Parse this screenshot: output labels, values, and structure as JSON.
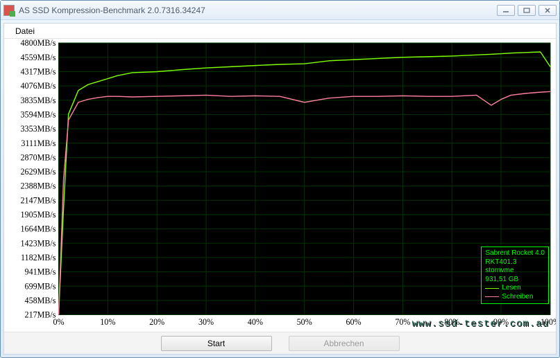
{
  "window": {
    "title": "AS SSD Kompression-Benchmark 2.0.7316.34247"
  },
  "menu": {
    "datei": "Datei"
  },
  "buttons": {
    "start": "Start",
    "abort": "Abbrechen"
  },
  "watermark": "www.ssd-tester.com.au",
  "legend": {
    "line1": "Sabrent Rocket 4.0",
    "line2": "RKT401.3",
    "line3": "stornvme",
    "line4": "931,51 GB",
    "read": "Lesen",
    "write": "Schreiben"
  },
  "chart_data": {
    "type": "line",
    "xlabel": "",
    "ylabel": "",
    "x_ticks": [
      "0%",
      "10%",
      "20%",
      "30%",
      "40%",
      "50%",
      "60%",
      "70%",
      "80%",
      "90%",
      "100%"
    ],
    "y_ticks": [
      "217MB/s",
      "458MB/s",
      "699MB/s",
      "941MB/s",
      "1182MB/s",
      "1423MB/s",
      "1664MB/s",
      "1905MB/s",
      "2147MB/s",
      "2388MB/s",
      "2629MB/s",
      "2870MB/s",
      "3111MB/s",
      "3353MB/s",
      "3594MB/s",
      "3835MB/s",
      "4076MB/s",
      "4317MB/s",
      "4559MB/s",
      "4800MB/s"
    ],
    "ylim": [
      217,
      4800
    ],
    "xlim": [
      0,
      100
    ],
    "x": [
      0,
      1,
      2,
      4,
      6,
      8,
      10,
      12,
      15,
      20,
      25,
      30,
      35,
      40,
      45,
      50,
      55,
      60,
      65,
      70,
      75,
      80,
      85,
      88,
      90,
      92,
      95,
      98,
      100
    ],
    "series": [
      {
        "name": "Lesen",
        "color": "#7fff00",
        "values": [
          217,
          2000,
          3600,
          4000,
          4100,
          4150,
          4200,
          4250,
          4300,
          4317,
          4350,
          4380,
          4400,
          4420,
          4440,
          4450,
          4500,
          4520,
          4540,
          4559,
          4570,
          4580,
          4600,
          4610,
          4620,
          4630,
          4640,
          4650,
          4400
        ]
      },
      {
        "name": "Schreiben",
        "color": "#ff7f9f",
        "values": [
          217,
          2500,
          3500,
          3800,
          3850,
          3880,
          3900,
          3900,
          3890,
          3900,
          3910,
          3920,
          3900,
          3910,
          3900,
          3800,
          3870,
          3900,
          3900,
          3910,
          3900,
          3900,
          3920,
          3750,
          3850,
          3920,
          3950,
          3970,
          3980
        ]
      }
    ]
  }
}
